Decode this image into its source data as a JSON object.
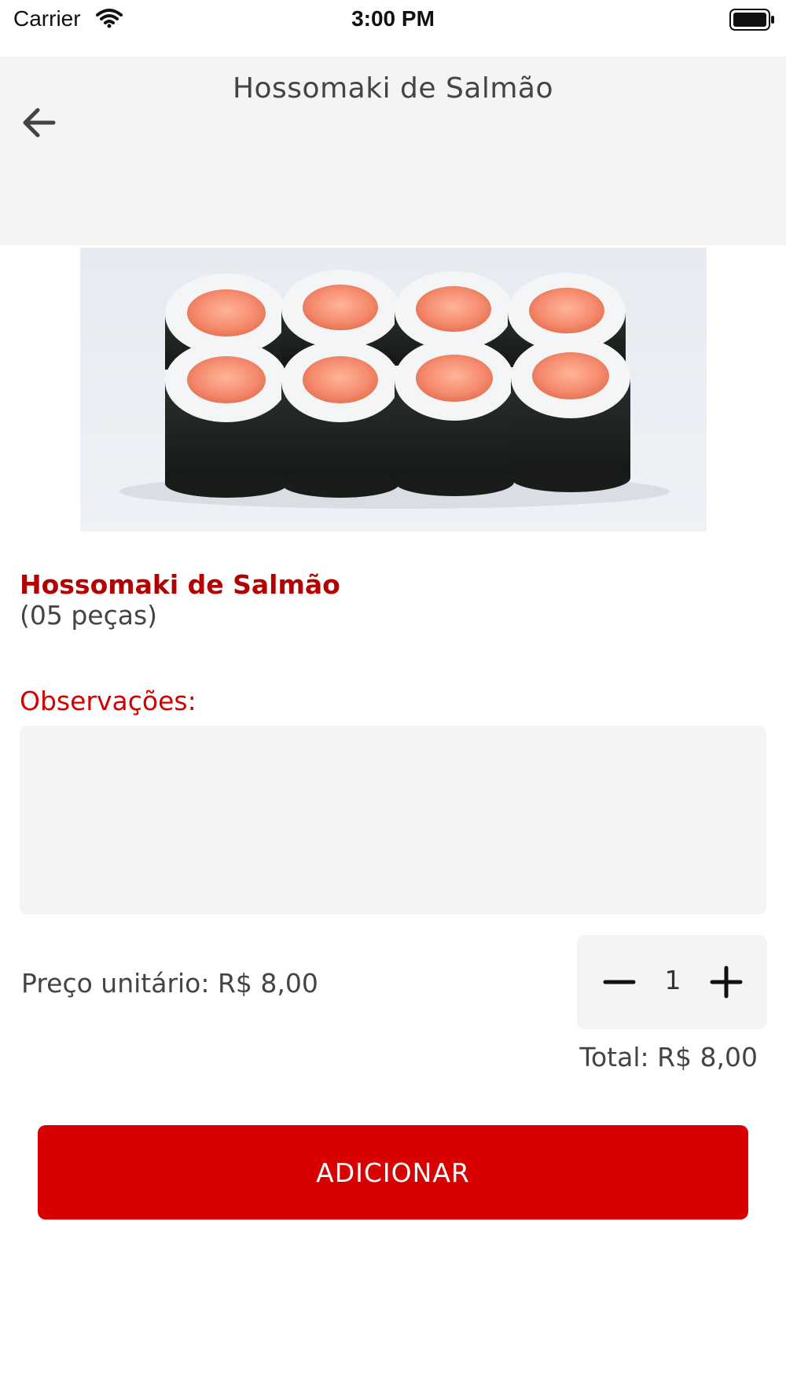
{
  "status_bar": {
    "carrier": "Carrier",
    "time": "3:00 PM"
  },
  "header": {
    "title": "Hossomaki de Salmão",
    "back_icon": "arrow-left-icon"
  },
  "product": {
    "image_alt": "salmon hossomaki rolls",
    "name": "Hossomaki de Salmão",
    "description": "(05 peças)"
  },
  "observations": {
    "label": "Observações:",
    "value": "",
    "placeholder": ""
  },
  "pricing": {
    "unit_price": "Preço unitário: R$ 8,00",
    "quantity": "1",
    "total": "Total: R$ 8,00"
  },
  "actions": {
    "add_label": "ADICIONAR"
  },
  "colors": {
    "accent": "#d80000",
    "title_red": "#b30000",
    "field_bg": "#f4f4f4",
    "text": "#444444"
  }
}
